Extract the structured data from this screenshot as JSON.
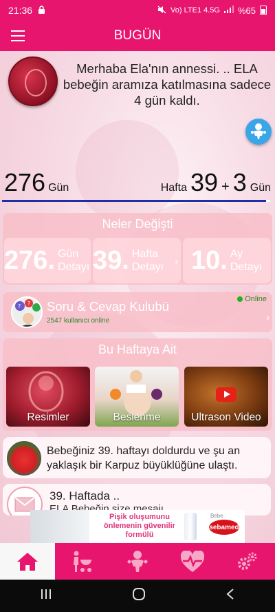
{
  "status_bar": {
    "time": "21:36",
    "network": "Vo) LTE1 4.5G",
    "battery": "%65"
  },
  "app_bar": {
    "title": "BUGÜN"
  },
  "welcome": {
    "message": "Merhaba Ela'nın annessi. .. ELA bebeğin aramıza katılmasına sadece 4 gün kaldı."
  },
  "counter": {
    "days_value": "276",
    "days_unit": "Gün",
    "weeks_label": "Hafta",
    "weeks_value": "39",
    "plus": "+",
    "extra_days_value": "3",
    "extra_days_unit": "Gün",
    "progress_fraction": 0.985
  },
  "changes": {
    "title": "Neler Değişti",
    "items": [
      {
        "num": "276.",
        "label": "Gün Detayı"
      },
      {
        "num": "39.",
        "label": "Hafta Detayı"
      },
      {
        "num": "10.",
        "label": "Ay Detayı"
      }
    ]
  },
  "club": {
    "title": "Soru & Cevap Kulubü",
    "online_count": "2547 kullanıcı online",
    "online_label": "Online"
  },
  "this_week": {
    "title": "Bu Haftaya Ait",
    "tiles": [
      "Resimler",
      "Beslenme",
      "Ultrason Video"
    ]
  },
  "fruit_card": {
    "text": "Bebeğiniz 39. haftayı doldurdu ve şu an yaklaşık bir Karpuz büyüklüğüne ulaştı."
  },
  "message_card": {
    "title": "39. Haftada ..",
    "subtitle": "ELA Bebeğin size mesajı"
  },
  "ad": {
    "text": "Pişik oluşumunu önlemenin güvenilir formülü",
    "brand_small": "Bebe",
    "brand": "sebamed"
  },
  "bottom_nav": [
    "home-icon",
    "stroller-icon",
    "baby-icon",
    "heart-rate-icon",
    "settings-icon"
  ],
  "colors": {
    "primary": "#e8156f",
    "panel": "#f8bec8",
    "progress": "#1e2fa8",
    "fab": "#3aa6e8",
    "online": "#1fb31f"
  }
}
